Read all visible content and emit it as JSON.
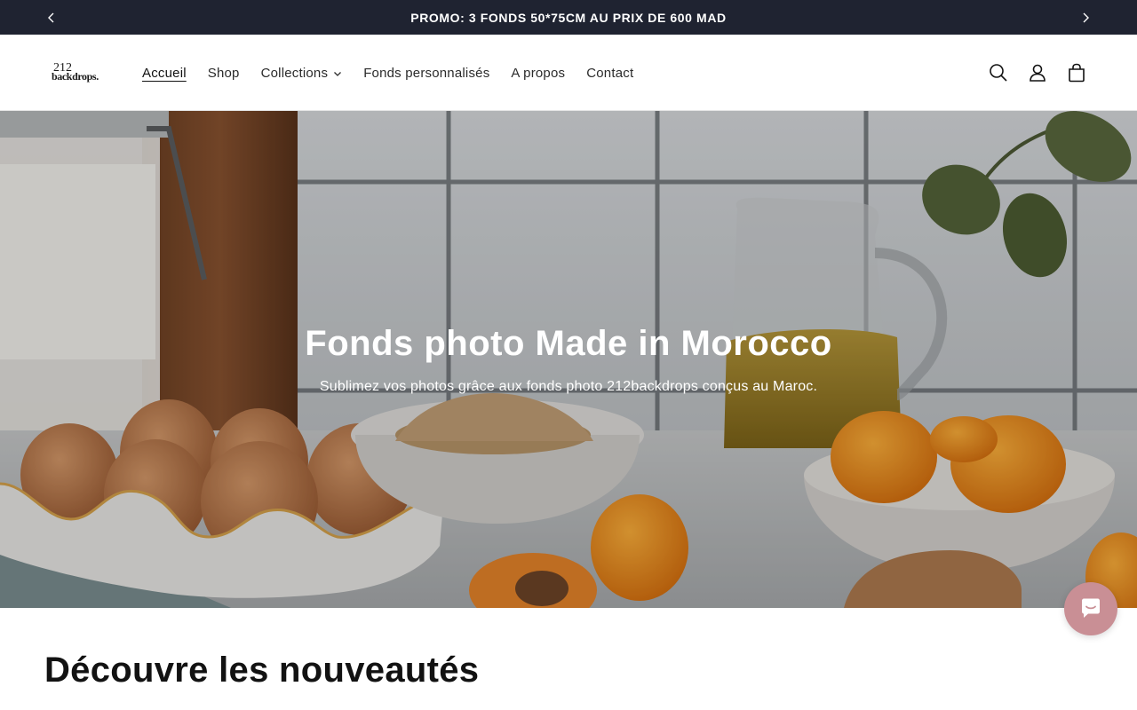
{
  "announcement": {
    "text": "PROMO: 3 FONDS 50*75CM AU PRIX DE 600 MAD",
    "prev_icon": "chevron-left-icon",
    "next_icon": "chevron-right-icon"
  },
  "logo": {
    "line1": "212",
    "line2": "backdrops."
  },
  "nav": {
    "items": [
      {
        "label": "Accueil",
        "active": true
      },
      {
        "label": "Shop"
      },
      {
        "label": "Collections",
        "has_dropdown": true
      },
      {
        "label": "Fonds personnalisés"
      },
      {
        "label": "A propos"
      },
      {
        "label": "Contact"
      }
    ]
  },
  "header_icons": [
    "search-icon",
    "account-icon",
    "cart-icon"
  ],
  "hero": {
    "title": "Fonds photo Made in Morocco",
    "subtitle": "Sublimez vos photos grâce aux fonds photo 212backdrops conçus au Maroc."
  },
  "section": {
    "title": "Découvre les nouveautés"
  },
  "chat": {
    "icon": "chat-icon",
    "color": "#c98f95"
  },
  "colors": {
    "announcement_bg": "#1f2331",
    "accent": "#c98f95"
  }
}
